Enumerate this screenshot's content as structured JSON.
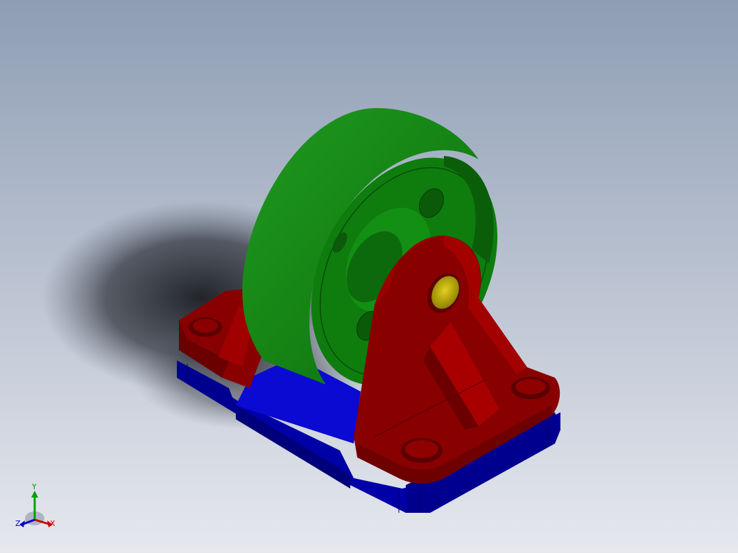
{
  "viewport": {
    "background_top": "#8e9db4",
    "background_bottom": "#e6e8ee"
  },
  "model": {
    "wheel_color": "#0d7a0d",
    "bracket_color": "#880000",
    "base_color": "#0000a8",
    "axle_color": "#c8b400"
  },
  "triad": {
    "x_label": "X",
    "y_label": "Y",
    "z_label": "Z",
    "x_color": "#cc0000",
    "y_color": "#00a000",
    "z_color": "#0000cc"
  }
}
